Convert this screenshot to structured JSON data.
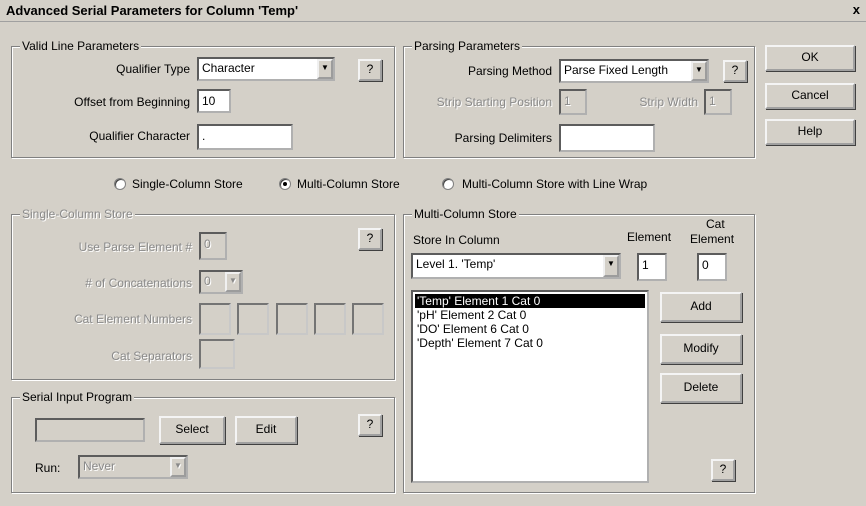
{
  "window": {
    "title": "Advanced Serial Parameters for Column 'Temp'",
    "close": "x"
  },
  "valid_line": {
    "legend": "Valid Line Parameters",
    "qualifier_type_label": "Qualifier Type",
    "qualifier_type_value": "Character",
    "offset_label": "Offset from Beginning",
    "offset_value": "10",
    "qualifier_char_label": "Qualifier Character",
    "qualifier_char_value": ".",
    "help": "?"
  },
  "parsing": {
    "legend": "Parsing Parameters",
    "method_label": "Parsing Method",
    "method_value": "Parse Fixed Length",
    "strip_start_label": "Strip Starting Position",
    "strip_start_value": "1",
    "strip_width_label": "Strip Width",
    "strip_width_value": "1",
    "delimiters_label": "Parsing Delimiters",
    "delimiters_value": "",
    "help": "?"
  },
  "buttons": {
    "ok": "OK",
    "cancel": "Cancel",
    "help": "Help"
  },
  "store_mode": {
    "single": "Single-Column Store",
    "multi": "Multi-Column Store",
    "multi_wrap": "Multi-Column Store with Line Wrap",
    "selected": "multi"
  },
  "single_store": {
    "legend": "Single-Column Store",
    "use_parse_label": "Use Parse Element #",
    "use_parse_value": "0",
    "concat_label": "# of Concatenations",
    "concat_value": "0",
    "cat_numbers_label": "Cat Element Numbers",
    "cat_sep_label": "Cat Separators",
    "help": "?"
  },
  "serial_program": {
    "legend": "Serial Input Program",
    "program_value": "",
    "select": "Select",
    "edit": "Edit",
    "run_label": "Run:",
    "run_value": "Never",
    "help": "?"
  },
  "multi_store": {
    "legend": "Multi-Column Store",
    "store_in_label": "Store In Column",
    "store_in_value": "Level 1. 'Temp'",
    "element_label": "Element",
    "element_value": "1",
    "cat_label": "Cat",
    "cat_element_label": "Element",
    "cat_value": "0",
    "items": [
      "'Temp' Element 1 Cat 0",
      "'pH' Element 2 Cat 0",
      "'DO' Element 6 Cat 0",
      "'Depth' Element 7 Cat 0"
    ],
    "add": "Add",
    "modify": "Modify",
    "delete": "Delete",
    "help": "?"
  }
}
